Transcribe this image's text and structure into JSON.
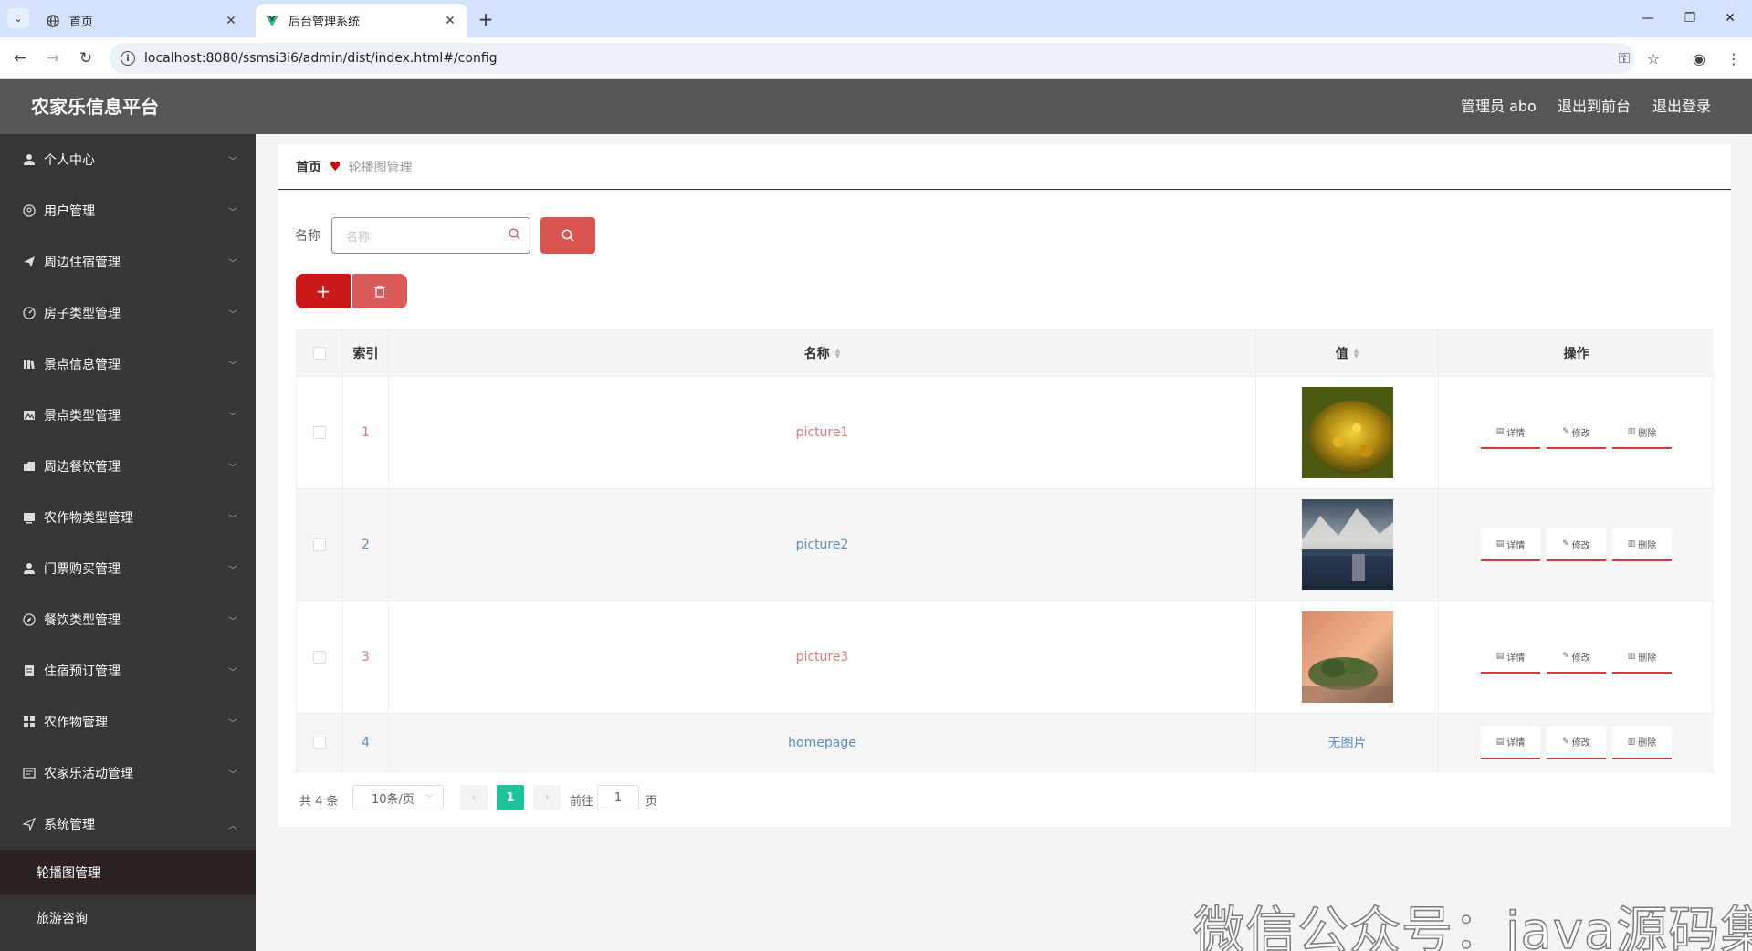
{
  "browser": {
    "tabs": [
      {
        "title": "首页",
        "active": false
      },
      {
        "title": "后台管理系统",
        "active": true
      }
    ],
    "url": "localhost:8080/ssmsi3i6/admin/dist/index.html#/config"
  },
  "header": {
    "title": "农家乐信息平台",
    "admin_label": "管理员 abo",
    "front_label": "退出到前台",
    "logout_label": "退出登录"
  },
  "sidebar": {
    "items": [
      {
        "label": "个人中心",
        "icon": "user-icon"
      },
      {
        "label": "用户管理",
        "icon": "circle-user-icon"
      },
      {
        "label": "周边住宿管理",
        "icon": "send-icon"
      },
      {
        "label": "房子类型管理",
        "icon": "gauge-icon"
      },
      {
        "label": "景点信息管理",
        "icon": "book-icon"
      },
      {
        "label": "景点类型管理",
        "icon": "picture-icon"
      },
      {
        "label": "周边餐饮管理",
        "icon": "folder-icon"
      },
      {
        "label": "农作物类型管理",
        "icon": "tablet-icon"
      },
      {
        "label": "门票购买管理",
        "icon": "user-icon"
      },
      {
        "label": "餐饮类型管理",
        "icon": "compass-icon"
      },
      {
        "label": "住宿预订管理",
        "icon": "document-icon"
      },
      {
        "label": "农作物管理",
        "icon": "grid-icon"
      },
      {
        "label": "农家乐活动管理",
        "icon": "list-icon"
      },
      {
        "label": "系统管理",
        "icon": "plane-icon",
        "expanded": true
      }
    ],
    "subitems": [
      {
        "label": "轮播图管理",
        "active": true
      },
      {
        "label": "旅游咨询",
        "active": false
      }
    ]
  },
  "breadcrumb": {
    "home": "首页",
    "current": "轮播图管理"
  },
  "search": {
    "label": "名称",
    "placeholder": "名称"
  },
  "table": {
    "headers": {
      "index": "索引",
      "name": "名称",
      "value": "值",
      "actions": "操作"
    },
    "action_labels": {
      "detail": "详情",
      "edit": "修改",
      "delete": "删除"
    },
    "rows": [
      {
        "index": "1",
        "name": "picture1",
        "value_type": "image",
        "image": "yellow-flower"
      },
      {
        "index": "2",
        "name": "picture2",
        "value_type": "image",
        "image": "mountain-lake"
      },
      {
        "index": "3",
        "name": "picture3",
        "value_type": "image",
        "image": "island-sunset"
      },
      {
        "index": "4",
        "name": "homepage",
        "value_type": "text",
        "value_text": "无图片"
      }
    ]
  },
  "pagination": {
    "total": "共 4 条",
    "page_size": "10条/页",
    "current_page": "1",
    "goto_label": "前往",
    "goto_value": "1",
    "page_suffix": "页"
  },
  "watermark": "微信公众号：java源码集合",
  "colors": {
    "header_bg": "#565656",
    "sidebar_bg": "#363636",
    "primary_red": "#d9534f",
    "add_red": "#cc1818",
    "pager_active": "#1ec39a"
  }
}
